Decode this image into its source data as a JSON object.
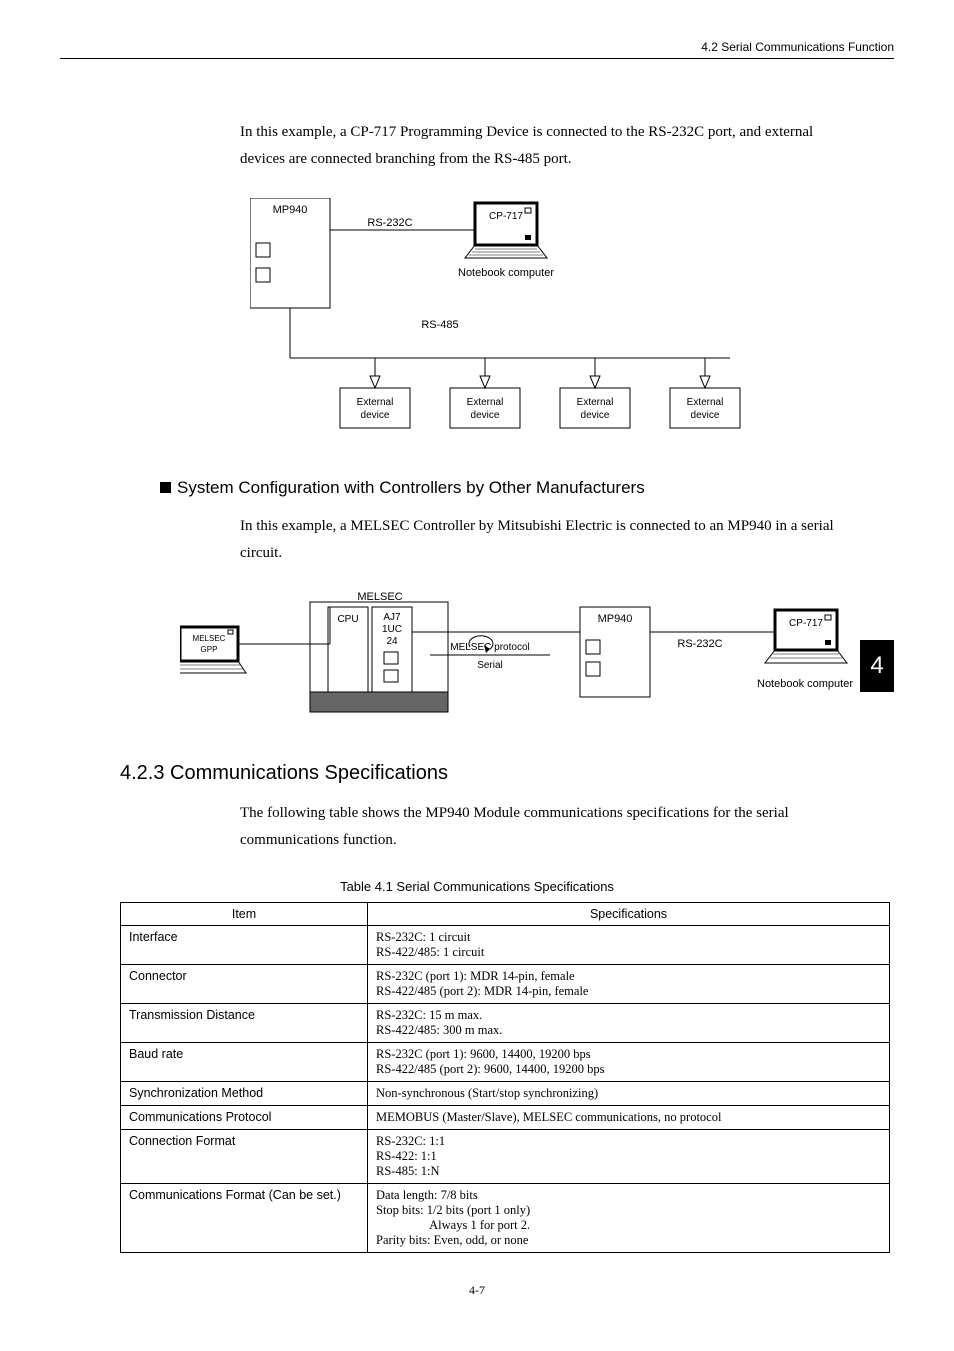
{
  "header": {
    "right": "4.2  Serial Communications Function"
  },
  "intro1": "In this example, a CP-717 Programming Device is connected to the RS-232C port, and external devices are connected branching from the RS-485 port.",
  "diagram1": {
    "mp940": "MP940",
    "rs232c": "RS-232C",
    "cp717": "CP-717",
    "notebook": "Notebook computer",
    "rs485": "RS-485",
    "ext": "External device"
  },
  "section_heading": "System Configuration with Controllers by Other Manufacturers",
  "intro2": "In this example, a MELSEC Controller by Mitsubishi Electric is connected to an MP940 in a serial circuit.",
  "diagram2": {
    "melsec_gpp": "MELSEC GPP",
    "melsec": "MELSEC",
    "cpu": "CPU",
    "aj": "AJ7\n1UC\n24",
    "melsec_protocol": "MELSEC protocol",
    "serial": "Serial",
    "mp940": "MP940",
    "rs232c": "RS-232C",
    "cp717": "CP-717",
    "notebook": "Notebook computer"
  },
  "side_tab": "4",
  "h_num": "4.2.3  Communications Specifications",
  "intro3": "The following table shows the MP940 Module communications specifications for the serial communications function.",
  "table_caption": "Table 4.1  Serial Communications Specifications",
  "table": {
    "head_item": "Item",
    "head_spec": "Specifications",
    "rows": [
      {
        "item": "Interface",
        "spec": "RS-232C: 1 circuit\nRS-422/485: 1 circuit"
      },
      {
        "item": "Connector",
        "spec": "RS-232C (port 1): MDR 14-pin, female\nRS-422/485 (port 2): MDR 14-pin, female"
      },
      {
        "item": "Transmission Distance",
        "spec": "RS-232C: 15 m max.\nRS-422/485: 300 m max."
      },
      {
        "item": "Baud rate",
        "spec": "RS-232C (port 1): 9600, 14400, 19200 bps\nRS-422/485 (port 2): 9600, 14400, 19200 bps"
      },
      {
        "item": "Synchronization Method",
        "spec": "Non-synchronous (Start/stop synchronizing)"
      },
      {
        "item": "Communications Protocol",
        "spec": "MEMOBUS (Master/Slave), MELSEC communications, no protocol"
      },
      {
        "item": "Connection Format",
        "spec": "RS-232C: 1:1\nRS-422: 1:1\nRS-485: 1:N"
      },
      {
        "item": "Communications Format (Can be set.)",
        "spec": "Data length: 7/8 bits\nStop bits: 1/2 bits (port 1 only)\n                 Always 1 for port 2.\nParity bits: Even, odd, or none"
      }
    ]
  },
  "footer": "4-7"
}
